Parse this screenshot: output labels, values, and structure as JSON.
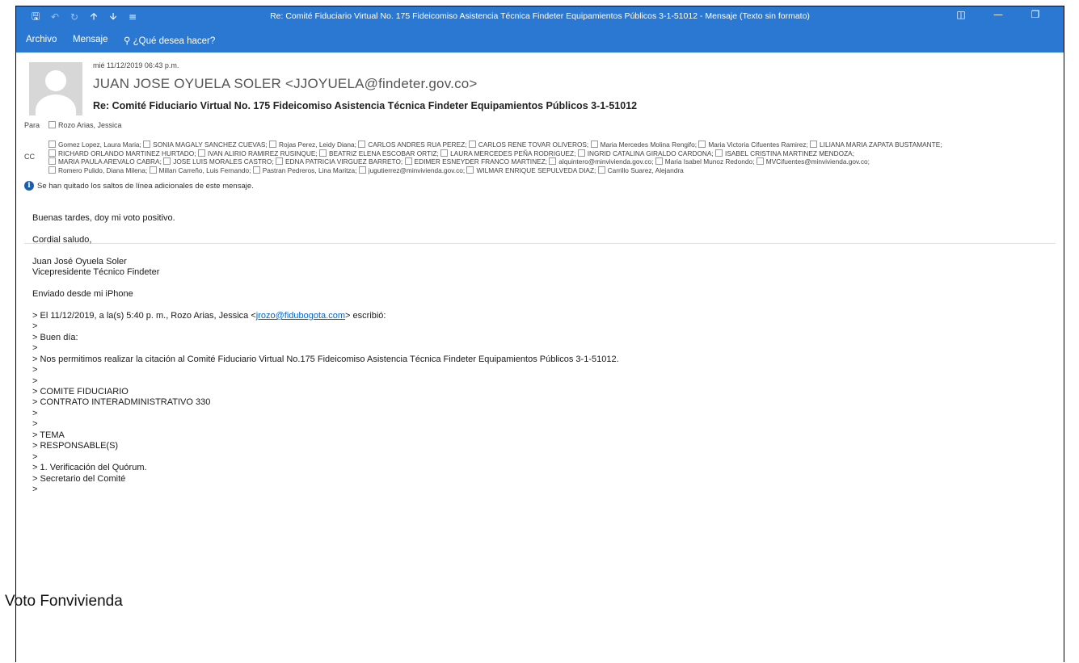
{
  "window": {
    "title": "Re: Comité Fiduciario Virtual No. 175 Fideicomiso Asistencia Técnica Findeter Equipamientos Públicos 3-1-51012 - Mensaje (Texto sin formato)",
    "qat_icons": [
      "save-icon",
      "undo-icon",
      "redo-icon",
      "up-arrow-icon",
      "down-arrow-icon",
      "customize-icon"
    ],
    "controls": [
      "ribbon-display-icon",
      "minimize-icon",
      "restore-icon"
    ]
  },
  "ribbon": {
    "tabs": [
      "Archivo",
      "Mensaje"
    ],
    "tell_me": "¿Qué desea hacer?"
  },
  "header": {
    "date": "mié 11/12/2019 06:43 p.m.",
    "from": "JUAN JOSE OYUELA SOLER <JJOYUELA@findeter.gov.co>",
    "subject": "Re: Comité Fiduciario Virtual No. 175 Fideicomiso Asistencia Técnica Findeter Equipamientos Públicos 3-1-51012",
    "to_label": "Para",
    "to": "Rozo Arias, Jessica",
    "cc_label": "CC",
    "cc_lines": [
      [
        "Gomez Lopez, Laura Maria;",
        "SONIA MAGALY SANCHEZ CUEVAS;",
        "Rojas Perez, Leidy Diana;",
        "CARLOS ANDRES RUA PEREZ;",
        "CARLOS RENE TOVAR OLIVEROS;",
        "Maria Mercedes Molina Rengifo;",
        "Maria Victoria Cifuentes Ramirez;",
        "LILIANA MARIA ZAPATA BUSTAMANTE;"
      ],
      [
        "RICHARD ORLANDO MARTINEZ HURTADO;",
        "IVAN ALIRIO RAMIREZ RUSINQUE;",
        "BEATRIZ ELENA ESCOBAR ORTIZ;",
        "LAURA MERCEDES PEÑA RODRIGUEZ;",
        "INGRID CATALINA GIRALDO CARDONA;",
        "ISABEL CRISTINA MARTINEZ MENDOZA;"
      ],
      [
        "MARIA PAULA AREVALO CABRA;",
        "JOSE LUIS MORALES CASTRO;",
        "EDNA PATRICIA VIRGUEZ BARRETO;",
        "EDIMER ESNEYDER FRANCO MARTINEZ;",
        "alquintero@minvivienda.gov.co;",
        "Maria Isabel Munoz Redondo;",
        "MVCifuentes@minvivienda.gov.co;"
      ],
      [
        "Romero Pulido, Diana Milena;",
        "Millan Carreño, Luis Fernando;",
        "Pastran Pedreros, Lina Maritza;",
        "jugutierrez@minvivienda.gov.co;",
        "WILMAR ENRIQUE SEPULVEDA DIAZ;",
        "Carrillo Suarez, Alejandra"
      ]
    ],
    "info": "Se han quitado los saltos de línea adicionales de este mensaje."
  },
  "body": {
    "lines": [
      "Buenas tardes, doy mi voto positivo.",
      "",
      "Cordial saludo,",
      "",
      "Juan José Oyuela Soler",
      "Vicepresidente Técnico Findeter",
      "",
      "Enviado desde mi iPhone",
      "",
      "> El 11/12/2019, a la(s) 5:40 p. m., Rozo Arias, Jessica <jrozo@fidubogota.com> escribió:",
      ">",
      "> Buen día:",
      ">",
      "> Nos permitimos realizar la citación al Comité Fiduciario Virtual No.175 Fideicomiso Asistencia Técnica Findeter Equipamientos Públicos 3-1-51012.",
      ">",
      ">",
      "> COMITE FIDUCIARIO",
      "> CONTRATO INTERADMINISTRATIVO 330",
      ">",
      ">",
      "> TEMA",
      "> RESPONSABLE(S)",
      ">",
      "> 1.   Verificación del Quórum.",
      "> Secretario del Comité",
      ">"
    ],
    "quote_prefix": "> El 11/12/2019, a la(s) 5:40 p. m., Rozo Arias, Jessica <",
    "quote_email": "jrozo@fidubogota.com",
    "quote_suffix": "> escribió:"
  },
  "caption": "Voto Fonvivienda"
}
